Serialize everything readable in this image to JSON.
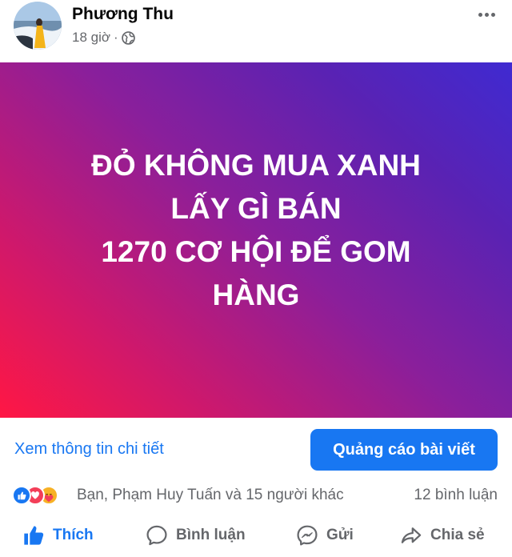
{
  "post": {
    "author": "Phương Thu",
    "time": "18 giờ",
    "separator": "·",
    "privacy_icon": "globe-icon"
  },
  "banner": {
    "lines": [
      "ĐỎ KHÔNG MUA XANH",
      "LẤY GÌ BÁN",
      "1270 CƠ HỘI ĐỂ GOM",
      "HÀNG"
    ],
    "gradient_colors": [
      "#ff1744",
      "#8a1f9b",
      "#3f2ad1"
    ]
  },
  "cta": {
    "details_link": "Xem thông tin chi tiết",
    "promote_button": "Quảng cáo bài viết"
  },
  "reactions": {
    "icons": [
      "like-reaction-icon",
      "love-reaction-icon",
      "care-reaction-icon"
    ],
    "names": "Bạn, Phạm Huy Tuấn và 15 người khác",
    "comments": "12 bình luận"
  },
  "actions": {
    "like": "Thích",
    "comment": "Bình luận",
    "send": "Gửi",
    "share": "Chia sẻ"
  },
  "colors": {
    "accent": "#1877f2",
    "muted_text": "#65676b"
  }
}
